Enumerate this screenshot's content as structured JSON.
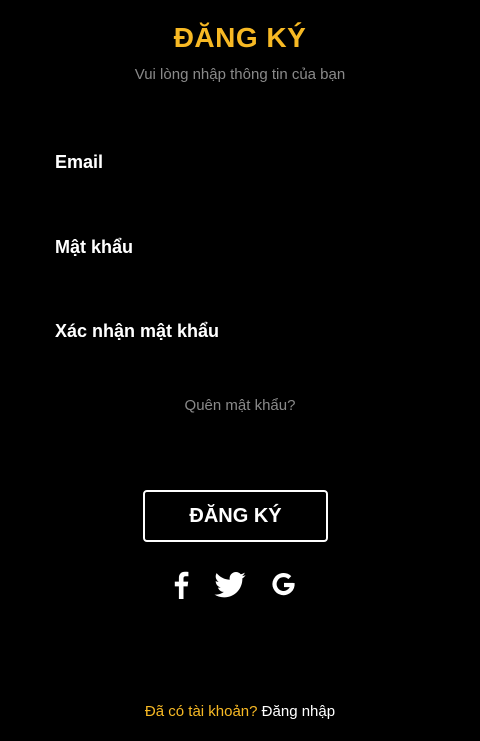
{
  "header": {
    "title": "ĐĂNG KÝ",
    "subtitle": "Vui lòng nhập thông tin của bạn"
  },
  "form": {
    "email_label": "Email",
    "email_value": "",
    "password_label": "Mật khẩu",
    "password_value": "",
    "confirm_label": "Xác nhận mật khẩu",
    "confirm_value": "",
    "forgot_label": "Quên mật khẩu?",
    "submit_label": "ĐĂNG KÝ"
  },
  "social": {
    "icons": [
      "facebook-icon",
      "twitter-icon",
      "google-icon"
    ]
  },
  "footer": {
    "question": "Đã có tài khoản?",
    "login_link": "Đăng nhập"
  },
  "colors": {
    "background": "#000000",
    "accent": "#F7B924",
    "muted_text": "#8a8a8a",
    "text": "#ffffff"
  }
}
